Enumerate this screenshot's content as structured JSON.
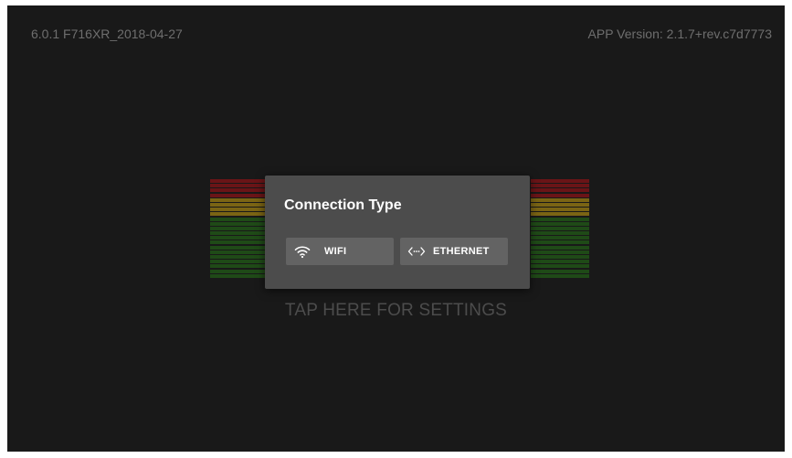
{
  "header": {
    "os_version": "6.0.1 F716XR_2018-04-27",
    "app_version": "APP Version: 2.1.7+rev.c7d7773"
  },
  "background": {
    "tap_hint": "TAP HERE FOR SETTINGS"
  },
  "dialog": {
    "title": "Connection Type",
    "buttons": [
      {
        "label": "WIFI",
        "icon": "wifi-icon"
      },
      {
        "label": "ETHERNET",
        "icon": "ethernet-icon"
      }
    ]
  },
  "colors": {
    "screen_bg": "#191919",
    "dialog_bg": "#4c4c4c",
    "button_bg": "#636363",
    "meter_red": "#6a1417",
    "meter_yellow": "#7a6414",
    "meter_green": "#1f4a17"
  }
}
